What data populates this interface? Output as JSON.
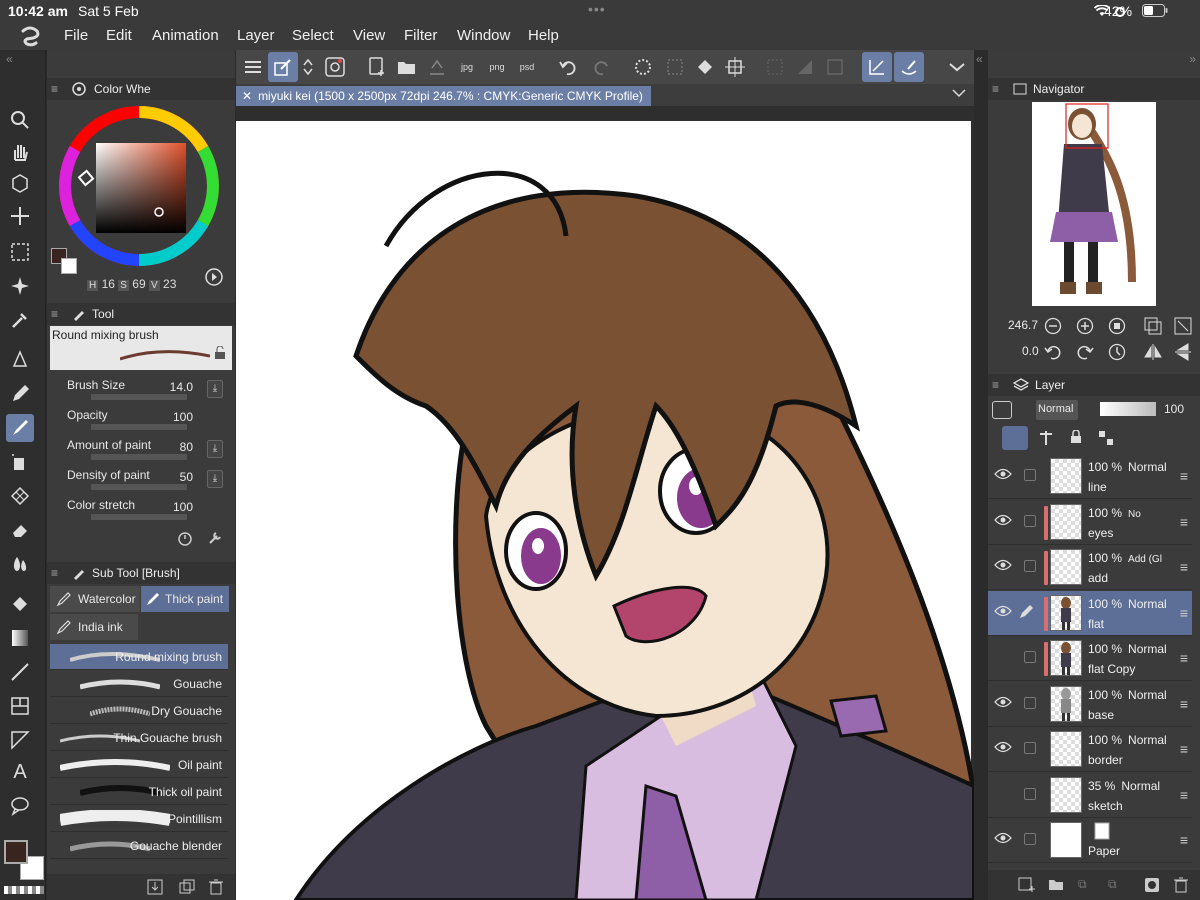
{
  "status": {
    "time": "10:42 am",
    "date": "Sat 5 Feb",
    "battery": "42%"
  },
  "menu": [
    "File",
    "Edit",
    "Animation",
    "Layer",
    "Select",
    "View",
    "Filter",
    "Window",
    "Help"
  ],
  "document": {
    "tab_title": "miyuki kei (1500 x 2500px 72dpi 246.7% : CMYK:Generic CMYK Profile)"
  },
  "color_wheel": {
    "panel_title": "Color Whe",
    "h_label": "H",
    "h": "16",
    "s_label": "S",
    "s": "69",
    "v_label": "V",
    "v": "23",
    "main_color": "#3a2420",
    "sub_color": "#ffffff"
  },
  "tool_property": {
    "panel_title": "Tool",
    "brush_name": "Round mixing brush",
    "props": [
      {
        "label": "Brush Size",
        "value": "14.0"
      },
      {
        "label": "Opacity",
        "value": "100"
      },
      {
        "label": "Amount of paint",
        "value": "80"
      },
      {
        "label": "Density of paint",
        "value": "50"
      },
      {
        "label": "Color stretch",
        "value": "100"
      }
    ]
  },
  "sub_tool": {
    "panel_title": "Sub Tool [Brush]",
    "groups": [
      "Watercolor",
      "Thick paint",
      "India ink"
    ],
    "active_group": "Thick paint",
    "items": [
      "Round mixing brush",
      "Gouache",
      "Dry Gouache",
      "Thin Gouache brush",
      "Oil paint",
      "Thick oil paint",
      "Pointillism",
      "Gouache blender"
    ],
    "selected": "Round mixing brush"
  },
  "navigator": {
    "panel_title": "Navigator",
    "zoom": "246.7",
    "rotation": "0.0"
  },
  "layer_panel": {
    "panel_title": "Layer",
    "blend_mode": "Normal",
    "opacity": "100",
    "layers": [
      {
        "percent": "100 %",
        "mode": "Normal",
        "name": "line",
        "visible": true,
        "color_bar": false,
        "selected": false
      },
      {
        "percent": "100 %",
        "mode": "No",
        "name": "eyes",
        "visible": true,
        "color_bar": true,
        "selected": false
      },
      {
        "percent": "100 %",
        "mode": "Add (Gl",
        "name": "add",
        "visible": true,
        "color_bar": true,
        "selected": false
      },
      {
        "percent": "100 %",
        "mode": "Normal",
        "name": "flat",
        "visible": true,
        "color_bar": true,
        "selected": true
      },
      {
        "percent": "100 %",
        "mode": "Normal",
        "name": "flat Copy",
        "visible": false,
        "color_bar": true,
        "selected": false
      },
      {
        "percent": "100 %",
        "mode": "Normal",
        "name": "base",
        "visible": true,
        "color_bar": false,
        "selected": false
      },
      {
        "percent": "100 %",
        "mode": "Normal",
        "name": "border",
        "visible": true,
        "color_bar": false,
        "selected": false
      },
      {
        "percent": "35 %",
        "mode": "Normal",
        "name": "sketch",
        "visible": false,
        "color_bar": false,
        "selected": false
      },
      {
        "percent": "",
        "mode": "",
        "name": "Paper",
        "visible": true,
        "color_bar": false,
        "selected": false
      }
    ]
  }
}
